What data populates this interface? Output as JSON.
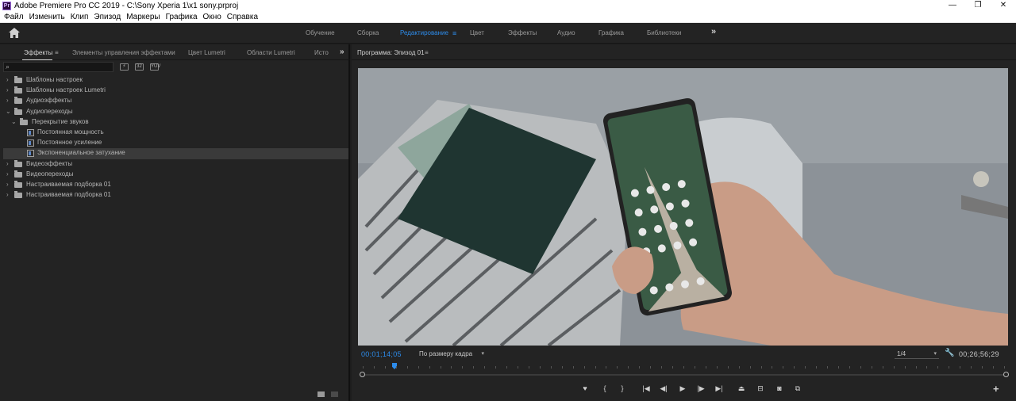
{
  "window": {
    "title": "Adobe Premiere Pro CC 2019 - C:\\Sony Xperia 1\\x1 sony.prproj",
    "app_icon": "Pr",
    "controls": {
      "minimize": "—",
      "maximize": "❐",
      "close": "✕"
    }
  },
  "menu": [
    "Файл",
    "Изменить",
    "Клип",
    "Эпизод",
    "Маркеры",
    "Графика",
    "Окно",
    "Справка"
  ],
  "workspaces": {
    "items": [
      "Обучение",
      "Сборка",
      "Редактирование",
      "Цвет",
      "Эффекты",
      "Аудио",
      "Графика",
      "Библиотеки"
    ],
    "active": "Редактирование",
    "menu_glyph": "≡",
    "more_glyph": "»"
  },
  "left_panel": {
    "tabs": [
      "Эффекты",
      "Элементы управления эффектами",
      "Цвет Lumetri",
      "Области Lumetri",
      "Исто"
    ],
    "tab_menu_glyph": "≡",
    "more_glyph": "»",
    "search": {
      "value": "",
      "placeholder": ""
    },
    "tree": [
      {
        "label": "Шаблоны настроек",
        "type": "folder",
        "level": 0,
        "expanded": false
      },
      {
        "label": "Шаблоны настроек Lumetri",
        "type": "folder",
        "level": 0,
        "expanded": false
      },
      {
        "label": "Аудиоэффекты",
        "type": "folder",
        "level": 0,
        "expanded": false
      },
      {
        "label": "Аудиопереходы",
        "type": "folder",
        "level": 0,
        "expanded": true
      },
      {
        "label": "Перекрытие звуков",
        "type": "folder",
        "level": 1,
        "expanded": true
      },
      {
        "label": "Постоянная мощность",
        "type": "effect",
        "level": 2
      },
      {
        "label": "Постоянное усиление",
        "type": "effect",
        "level": 2
      },
      {
        "label": "Экспоненциальное затухание",
        "type": "effect",
        "level": 2,
        "selected": true
      },
      {
        "label": "Видеоэффекты",
        "type": "folder",
        "level": 0,
        "expanded": false
      },
      {
        "label": "Видеопереходы",
        "type": "folder",
        "level": 0,
        "expanded": false
      },
      {
        "label": "Настраиваемая подборка 01",
        "type": "folder",
        "level": 0,
        "expanded": false
      },
      {
        "label": "Настраиваемая подборка 01",
        "type": "folder",
        "level": 0,
        "expanded": false
      }
    ]
  },
  "program": {
    "title": "Программа: Эпизод 01",
    "menu_glyph": "≡",
    "timecode_current": "00;01;14;05",
    "fit": "По размеру кадра",
    "resolution": "1/4",
    "timecode_duration": "00;26;56;29",
    "playhead_fraction": 0.046
  },
  "colors": {
    "accent": "#2d8ceb",
    "panel_bg": "#232323",
    "selected_row": "#3a3a3a"
  }
}
